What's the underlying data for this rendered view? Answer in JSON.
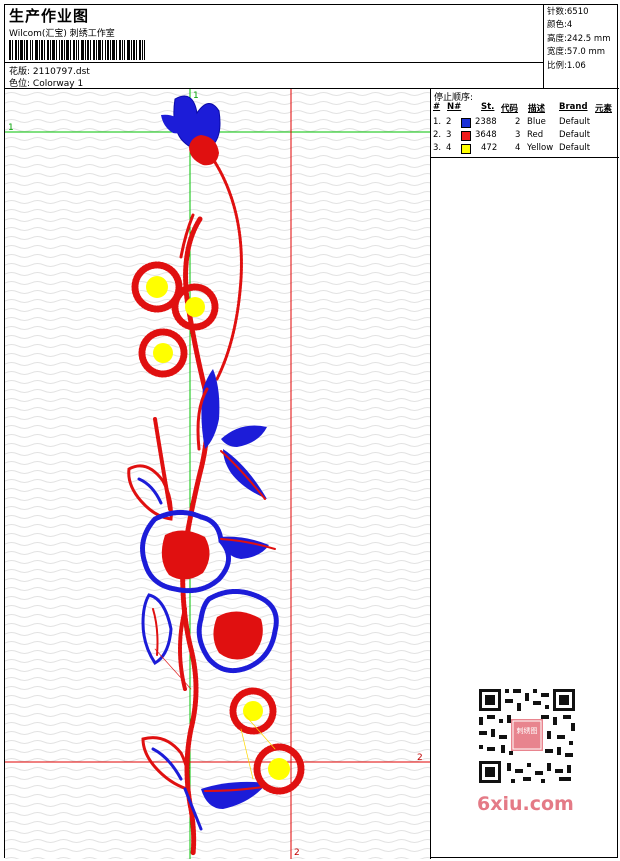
{
  "header": {
    "title": "生产作业图",
    "subtitle": "Wilcom(汇宝) 刺绣工作室",
    "design_label": "花版:",
    "design_value": "2110797.dst",
    "color_label": "色位:",
    "color_value": "Colorway 1"
  },
  "stats": [
    {
      "label": "针数:",
      "value": "6510"
    },
    {
      "label": "颜色:",
      "value": "4"
    },
    {
      "label": "高度:",
      "value": "242.5 mm"
    },
    {
      "label": "宽度:",
      "value": "57.0 mm"
    },
    {
      "label": "比例:",
      "value": "1.06"
    }
  ],
  "canvas": {
    "guide_h_green_label": "1",
    "guide_v_green_label": "1",
    "guide_h_red_label": "2",
    "guide_v_red_label": "2",
    "colors": {
      "green": "#00c000",
      "red": "#e00000",
      "blue": "#1c1cd8",
      "yellow": "#ffff00"
    }
  },
  "stop_panel": {
    "title": "停止顺序:",
    "headers": {
      "num": "#",
      "needle": "N#",
      "stitches": "St.",
      "code": "代码",
      "desc": "描述",
      "brand": "Brand",
      "element": "元素"
    },
    "rows": [
      {
        "num": "1.",
        "needle": "2",
        "color": "#1a2fd6",
        "stitches": "2388",
        "code": "2",
        "desc": "Blue",
        "brand": "Default"
      },
      {
        "num": "2.",
        "needle": "3",
        "color": "#ee1c1c",
        "stitches": "3648",
        "code": "3",
        "desc": "Red",
        "brand": "Default"
      },
      {
        "num": "3.",
        "needle": "4",
        "color": "#ffff00",
        "stitches": "472",
        "code": "4",
        "desc": "Yellow",
        "brand": "Default"
      }
    ]
  },
  "watermark": {
    "site": "6xiu.com",
    "seal_text": "刺绣图"
  }
}
